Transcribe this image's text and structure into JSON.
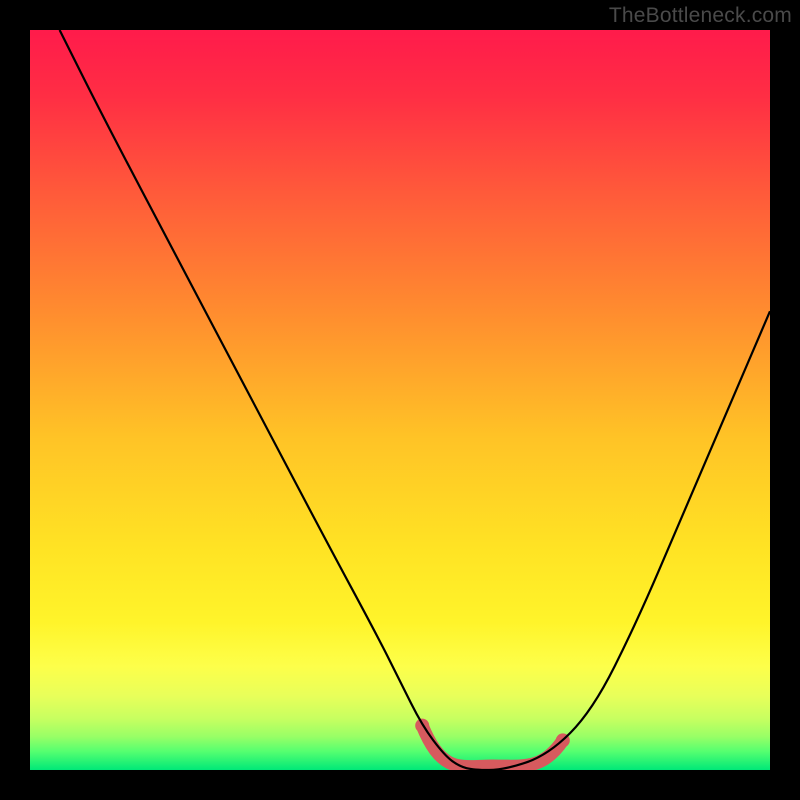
{
  "watermark": "TheBottleneck.com",
  "chart_data": {
    "type": "line",
    "title": "",
    "xlabel": "",
    "ylabel": "",
    "xlim": [
      0,
      100
    ],
    "ylim": [
      0,
      100
    ],
    "series": [
      {
        "name": "curve",
        "x": [
          4,
          10,
          20,
          30,
          40,
          47,
          50,
          53,
          56,
          58,
          60,
          64,
          70,
          76,
          82,
          88,
          94,
          100
        ],
        "values": [
          100,
          88,
          69,
          50,
          31,
          18,
          12,
          6,
          2,
          0.5,
          0,
          0,
          2,
          8,
          20,
          34,
          48,
          62
        ]
      }
    ],
    "trough_range_x": [
      53,
      72
    ],
    "gradient_stops": [
      {
        "offset": 0.0,
        "color": "#ff1b4b"
      },
      {
        "offset": 0.09,
        "color": "#ff2e44"
      },
      {
        "offset": 0.22,
        "color": "#ff5a3a"
      },
      {
        "offset": 0.38,
        "color": "#ff8c2f"
      },
      {
        "offset": 0.55,
        "color": "#ffc326"
      },
      {
        "offset": 0.7,
        "color": "#ffe324"
      },
      {
        "offset": 0.8,
        "color": "#fff42a"
      },
      {
        "offset": 0.86,
        "color": "#fdff4a"
      },
      {
        "offset": 0.9,
        "color": "#e8ff5a"
      },
      {
        "offset": 0.93,
        "color": "#c8ff60"
      },
      {
        "offset": 0.955,
        "color": "#98ff66"
      },
      {
        "offset": 0.975,
        "color": "#55ff70"
      },
      {
        "offset": 1.0,
        "color": "#00e878"
      }
    ]
  }
}
